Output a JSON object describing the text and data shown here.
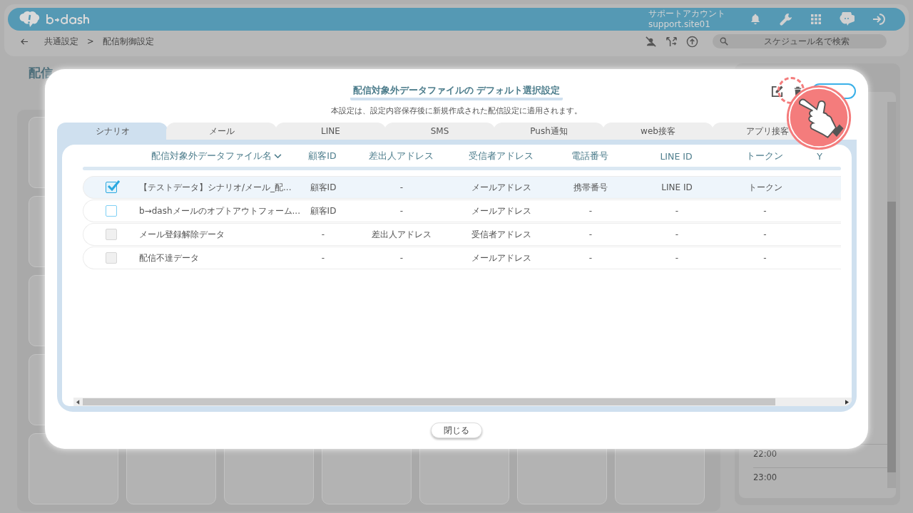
{
  "header": {
    "account_name": "サポートアカウント",
    "account_id": "support.site01"
  },
  "breadcrumb": [
    "共通設定",
    "配信制御設定"
  ],
  "breadcrumb_separator": ">",
  "search": {
    "placeholder": "スケジュール名で検索"
  },
  "page_heading": "配信",
  "timeline": {
    "times": [
      "22:00",
      "23:00"
    ]
  },
  "dialog": {
    "title": "配信対象外データファイルの デフォルト選択設定",
    "subtitle": "本設定は、設定内容保存後に新規作成された配信設定に適用されます。",
    "tabs": [
      {
        "label": "シナリオ",
        "selected": true
      },
      {
        "label": "メール",
        "selected": false
      },
      {
        "label": "LINE",
        "selected": false
      },
      {
        "label": "SMS",
        "selected": false
      },
      {
        "label": "Push通知",
        "selected": false
      },
      {
        "label": "web接客",
        "selected": false
      },
      {
        "label": "アプリ接客",
        "selected": false
      }
    ],
    "columns": [
      {
        "label": "配信対象外データファイル名",
        "sortable": true
      },
      {
        "label": "顧客ID"
      },
      {
        "label": "差出人アドレス"
      },
      {
        "label": "受信者アドレス"
      },
      {
        "label": "電話番号"
      },
      {
        "label": "LINE ID"
      },
      {
        "label": "トークン"
      },
      {
        "label": "Y"
      }
    ],
    "rows": [
      {
        "checked": true,
        "disabled": false,
        "selected": true,
        "cells": [
          "【テストデータ】シナリオ/メール_配...",
          "顧客ID",
          "-",
          "メールアドレス",
          "携帯番号",
          "LINE ID",
          "トークン"
        ]
      },
      {
        "checked": false,
        "disabled": false,
        "selected": false,
        "cells": [
          "b→dashメールのオプトアウトフォーム...",
          "顧客ID",
          "-",
          "メールアドレス",
          "-",
          "-",
          "-"
        ]
      },
      {
        "checked": false,
        "disabled": true,
        "selected": false,
        "cells": [
          "メール登録解除データ",
          "-",
          "差出人アドレス",
          "受信者アドレス",
          "-",
          "-",
          "-"
        ]
      },
      {
        "checked": false,
        "disabled": true,
        "selected": false,
        "cells": [
          "配信不達データ",
          "-",
          "-",
          "メールアドレス",
          "-",
          "-",
          "-"
        ]
      }
    ],
    "close_button": "閉じる"
  }
}
